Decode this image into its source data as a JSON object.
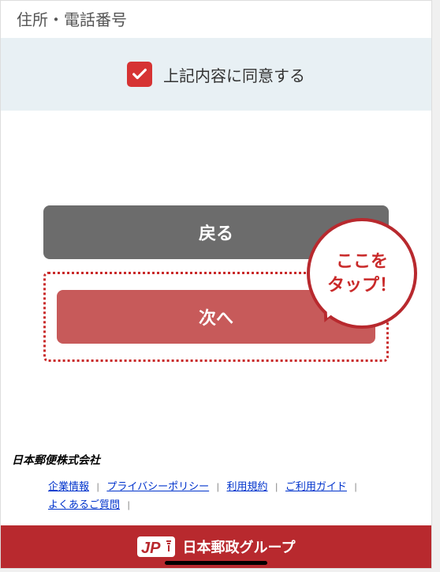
{
  "header": {
    "label": "住所・電話番号"
  },
  "consent": {
    "checked": true,
    "label": "上記内容に同意する"
  },
  "buttons": {
    "back": "戻る",
    "next": "次へ"
  },
  "callout": {
    "line1": "ここを",
    "line2": "タップ！"
  },
  "footer": {
    "company": "日本郵便株式会社",
    "links": {
      "corporate": "企業情報",
      "privacy": "プライバシーポリシー",
      "terms": "利用規約",
      "guide": "ご利用ガイド",
      "faq": "よくあるご質問"
    },
    "group": "日本郵政グループ"
  }
}
